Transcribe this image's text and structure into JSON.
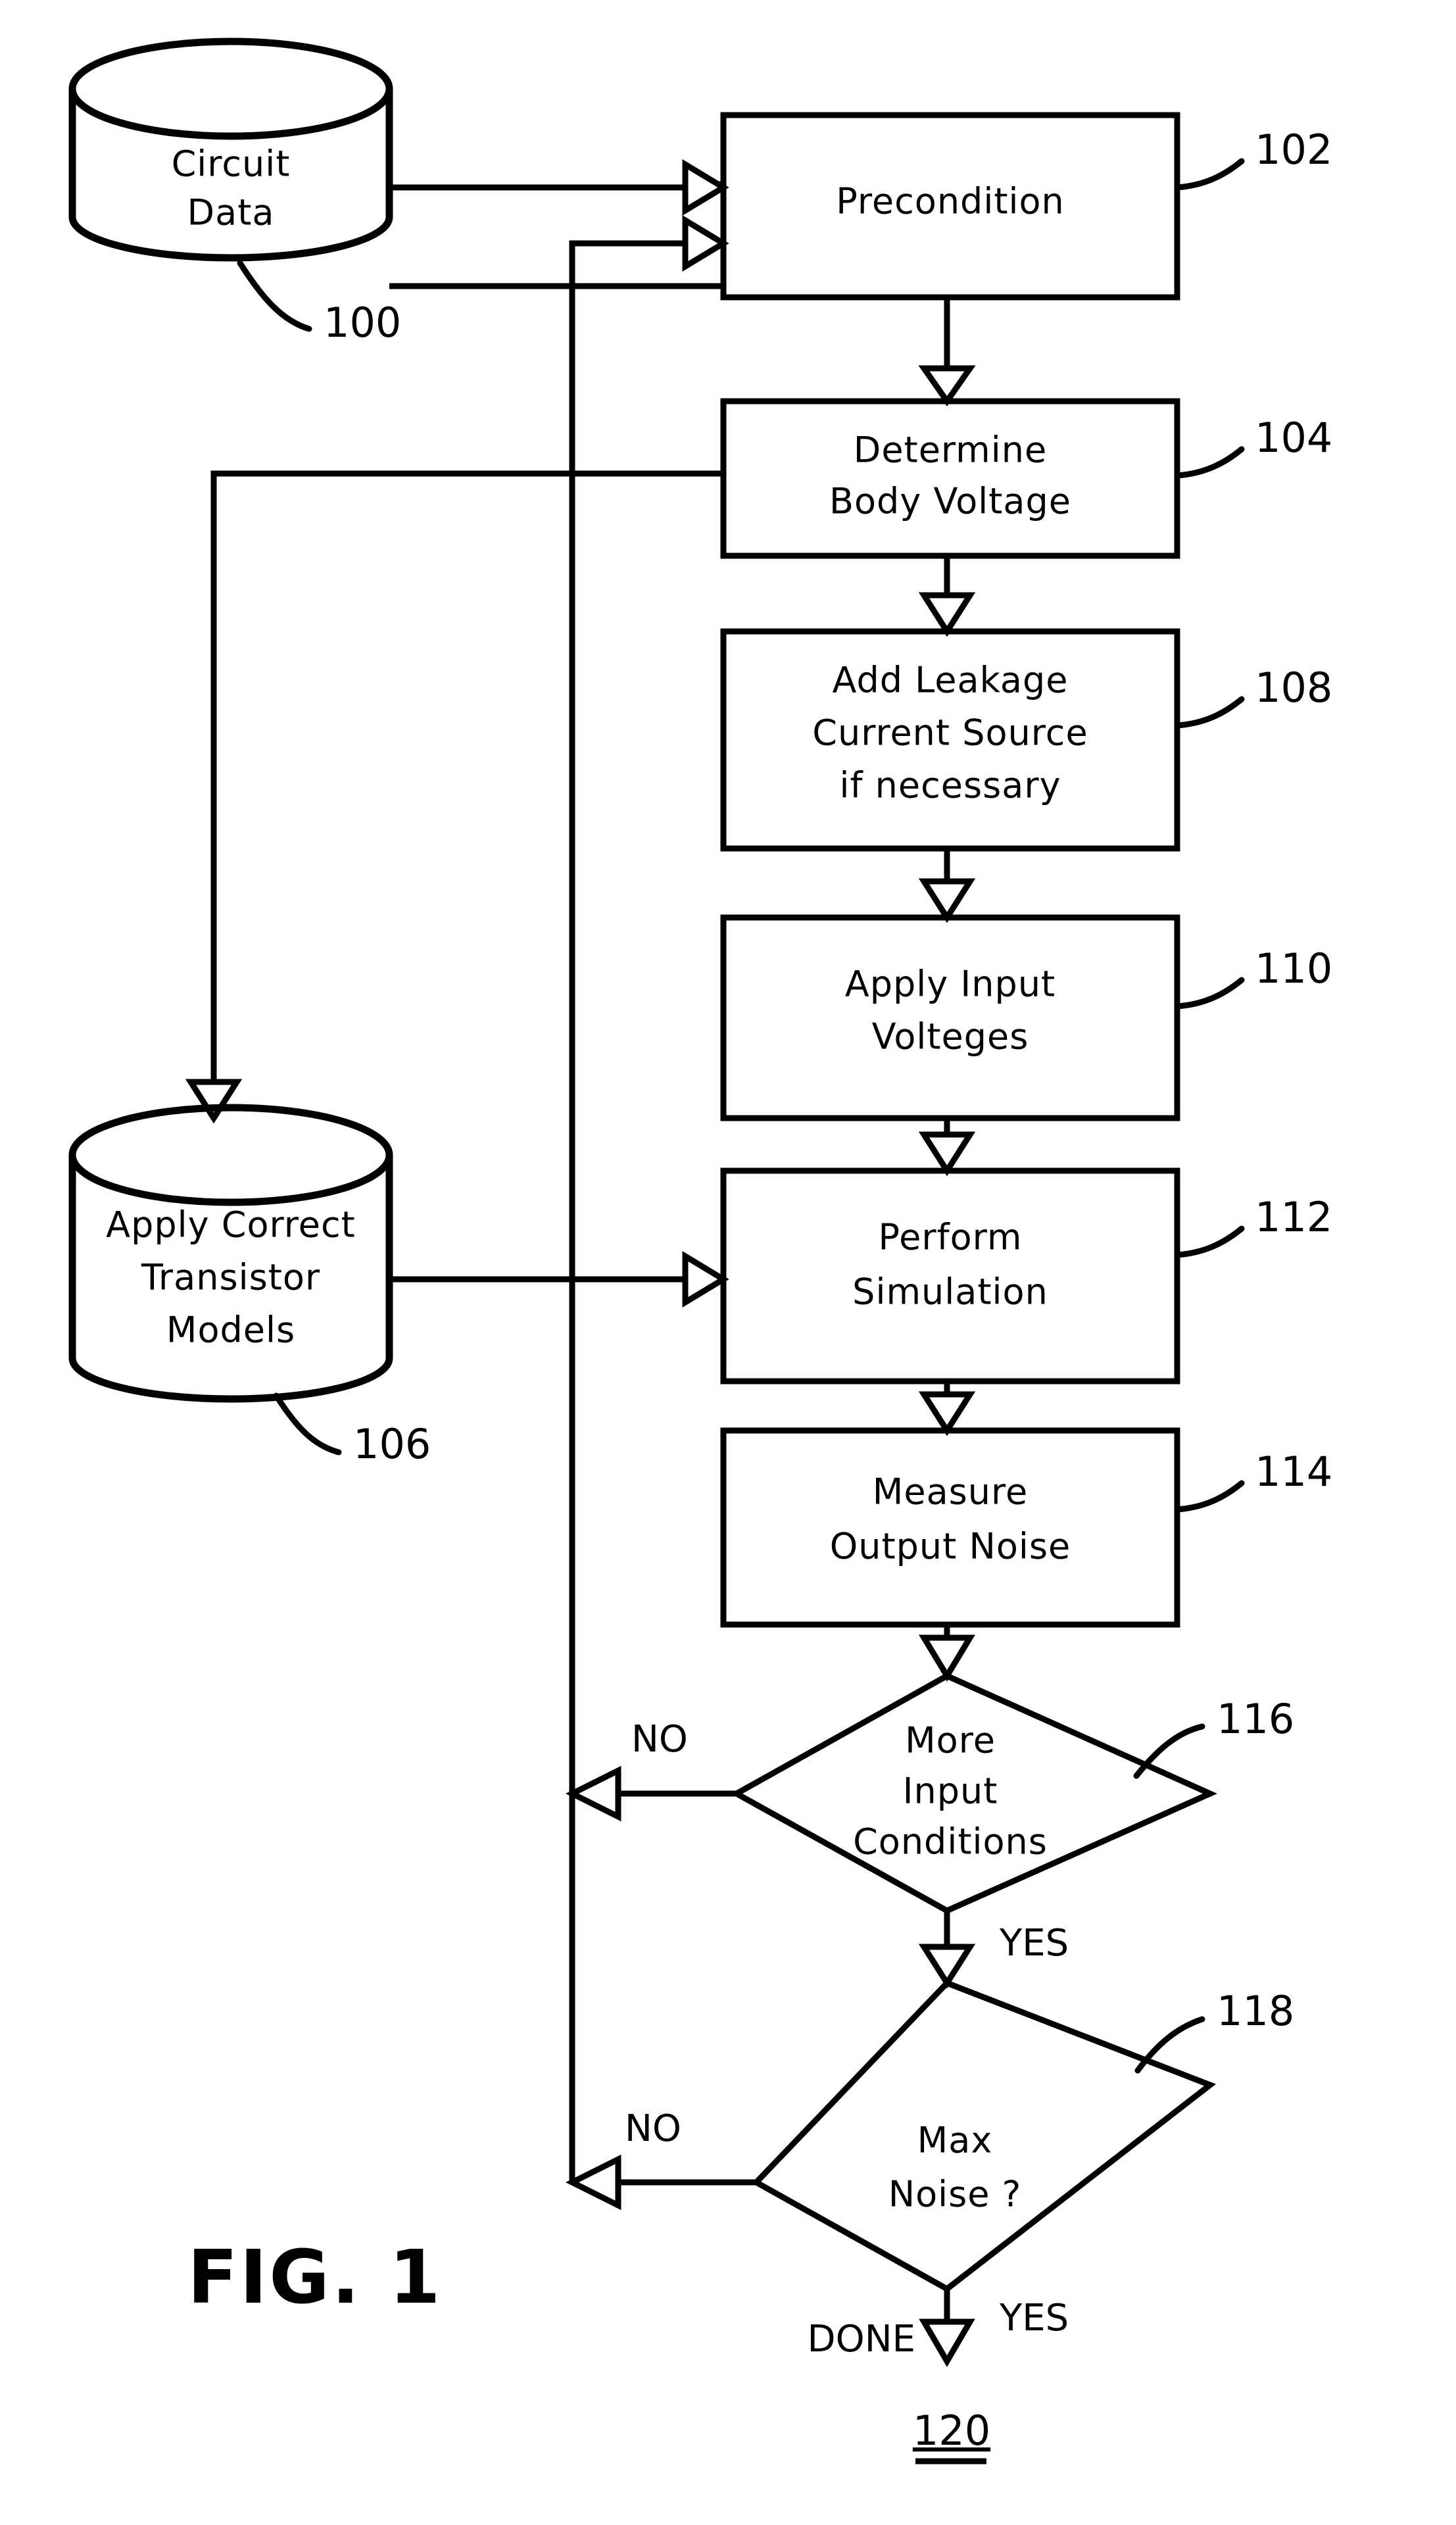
{
  "figure": {
    "label": "FIG.  1"
  },
  "nodes": {
    "circuit_data": {
      "id": "100",
      "lines": [
        "Circuit",
        "Data"
      ],
      "shape": "cylinder"
    },
    "precondition": {
      "id": "102",
      "lines": [
        "Precondition"
      ],
      "shape": "process"
    },
    "determine_body_voltage": {
      "id": "104",
      "lines": [
        "Determine",
        "Body  Voltage"
      ],
      "shape": "process"
    },
    "transistor_models": {
      "id": "106",
      "lines": [
        "Apply  Correct",
        "Transistor",
        "Models"
      ],
      "shape": "cylinder"
    },
    "add_leakage": {
      "id": "108",
      "lines": [
        "Add  Leakage",
        "Current  Source",
        "if  necessary"
      ],
      "shape": "process"
    },
    "apply_input_voltages": {
      "id": "110",
      "lines": [
        "Apply  Input",
        "Volteges"
      ],
      "shape": "process"
    },
    "perform_simulation": {
      "id": "112",
      "lines": [
        "Perform",
        "Simulation"
      ],
      "shape": "process"
    },
    "measure_output_noise": {
      "id": "114",
      "lines": [
        "Measure",
        "Output  Noise"
      ],
      "shape": "process"
    },
    "more_input_conditions": {
      "id": "116",
      "lines": [
        "More",
        "Input",
        "Conditions"
      ],
      "shape": "decision"
    },
    "max_noise": {
      "id": "118",
      "lines": [
        "Max",
        "Noise ?"
      ],
      "shape": "decision"
    },
    "end": {
      "id": "120",
      "label": "DONE"
    }
  },
  "branch_labels": {
    "more_input_no": "NO",
    "more_input_yes": "YES",
    "max_noise_no": "NO",
    "max_noise_yes": "YES"
  },
  "colors": {
    "ink": "#000000",
    "paper": "#ffffff"
  }
}
